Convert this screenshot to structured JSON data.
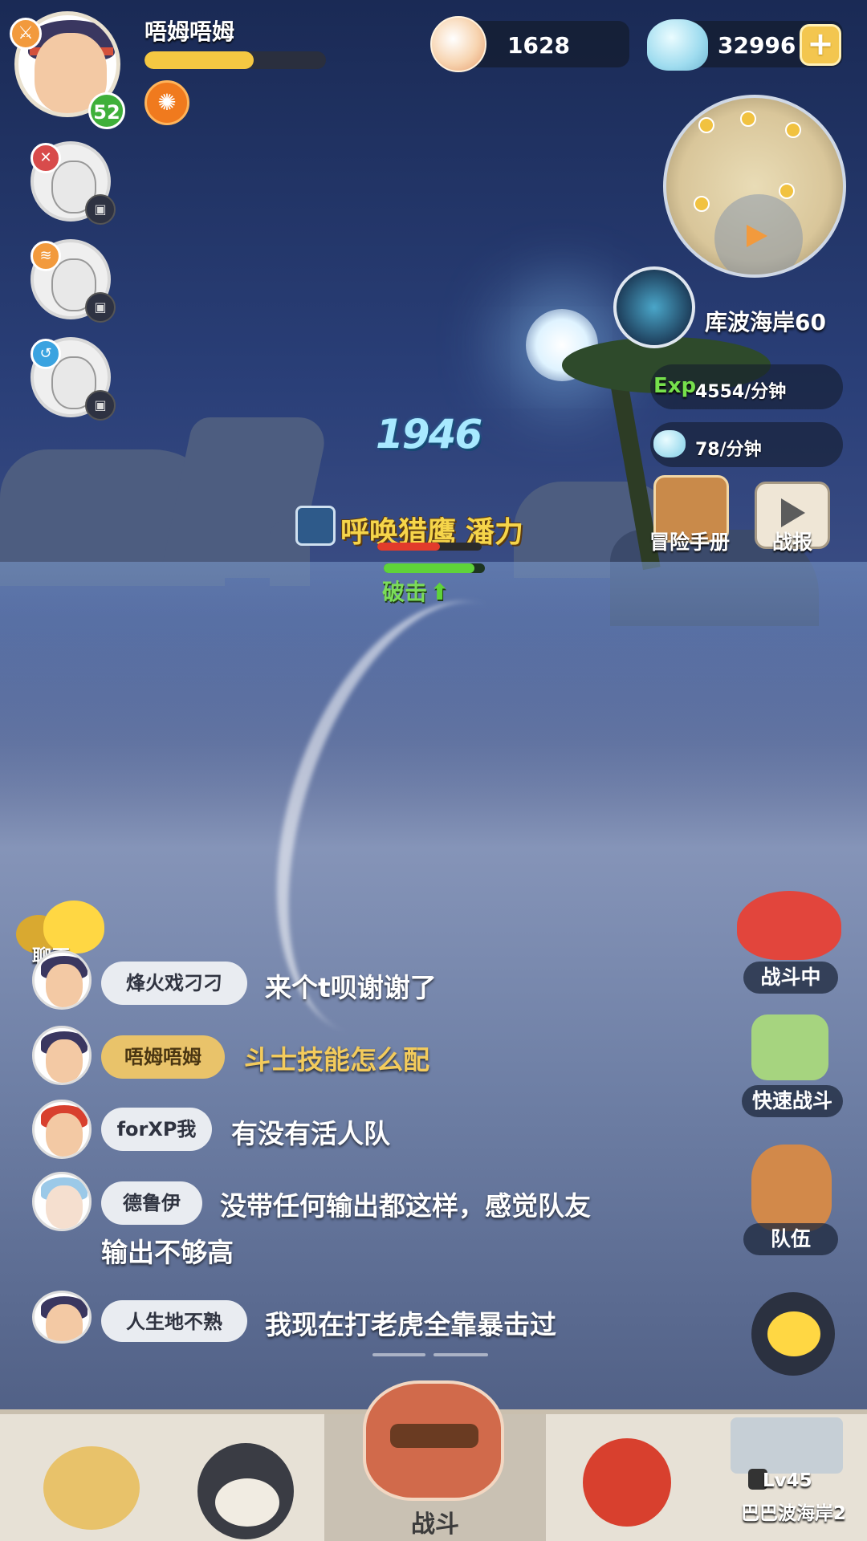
{
  "player": {
    "name": "唔姆唔姆",
    "level": "52",
    "xp_fraction": 0.6
  },
  "currency": {
    "pearls": "1628",
    "shells": "32996",
    "add_symbol": "+"
  },
  "area": {
    "name": "库波海岸60",
    "exp_label": "Exp",
    "exp_rate": "4554/分钟",
    "shell_rate": "78/分钟"
  },
  "side_buttons": {
    "adventure_manual": "冒险手册",
    "battle_report": "战报",
    "in_battle": "战斗中",
    "quick_battle": "快速战斗",
    "team": "队伍"
  },
  "battle": {
    "damage": "1946",
    "skill_name": "呼唤猎鹰",
    "skill_name_2": "潘力",
    "status_text": "破击",
    "enemy_hp_fraction": 0.6,
    "ally_hp_fraction": 0.9
  },
  "chat": {
    "title": "聊天",
    "messages": [
      {
        "name": "烽火戏刁刁",
        "text": "来个t呗谢谢了"
      },
      {
        "name": "唔姆唔姆",
        "text": "斗士技能怎么配"
      },
      {
        "name": "forXP我",
        "text": "有没有活人队"
      },
      {
        "name": "德鲁伊",
        "text": "没带任何输出都这样，感觉队友",
        "text2": "输出不够高"
      },
      {
        "name": "人生地不熟",
        "text": "我现在打老虎全靠暴击过"
      }
    ]
  },
  "nav": {
    "battle": "战斗",
    "locked_level": "Lv45",
    "locked_area": "巴巴波海岸2"
  },
  "colors": {
    "accent_gold": "#f3c64f",
    "exp_green": "#76e04c",
    "level_green": "#3fb03a"
  }
}
